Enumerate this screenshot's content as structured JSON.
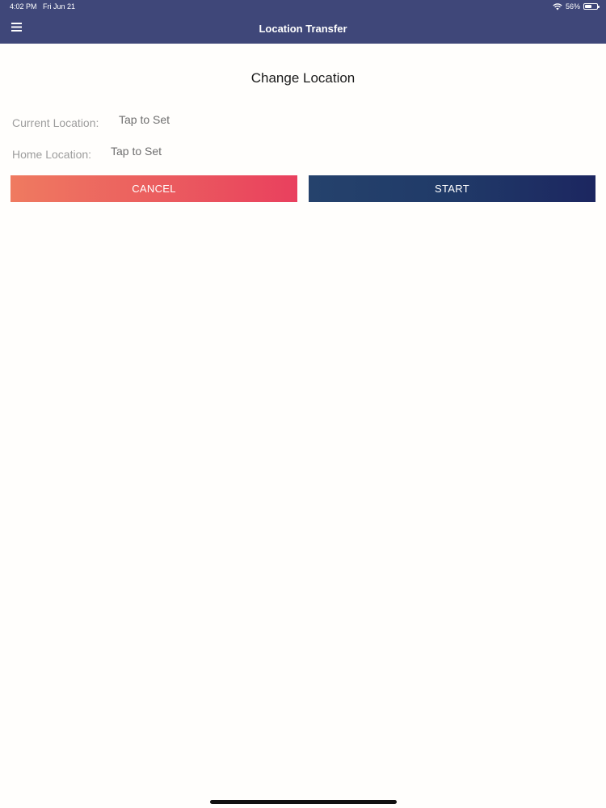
{
  "status_bar": {
    "time": "4:02 PM",
    "date": "Fri Jun 21",
    "battery_percent": "56%",
    "battery_level": 0.56
  },
  "header": {
    "title": "Location Transfer",
    "menu_icon": "hamburger-menu-icon"
  },
  "main": {
    "heading": "Change Location",
    "current_location": {
      "label": "Current Location:",
      "value": "Tap to Set"
    },
    "home_location": {
      "label": "Home Location:",
      "value": "Tap to Set"
    },
    "actions": {
      "cancel_label": "CANCEL",
      "start_label": "START"
    }
  },
  "colors": {
    "header_bg": "#3f4779",
    "cancel_gradient": [
      "#ef7a60",
      "#e9405e"
    ],
    "start_gradient": [
      "#25426c",
      "#1c2660"
    ],
    "page_bg": "#fffefc"
  }
}
